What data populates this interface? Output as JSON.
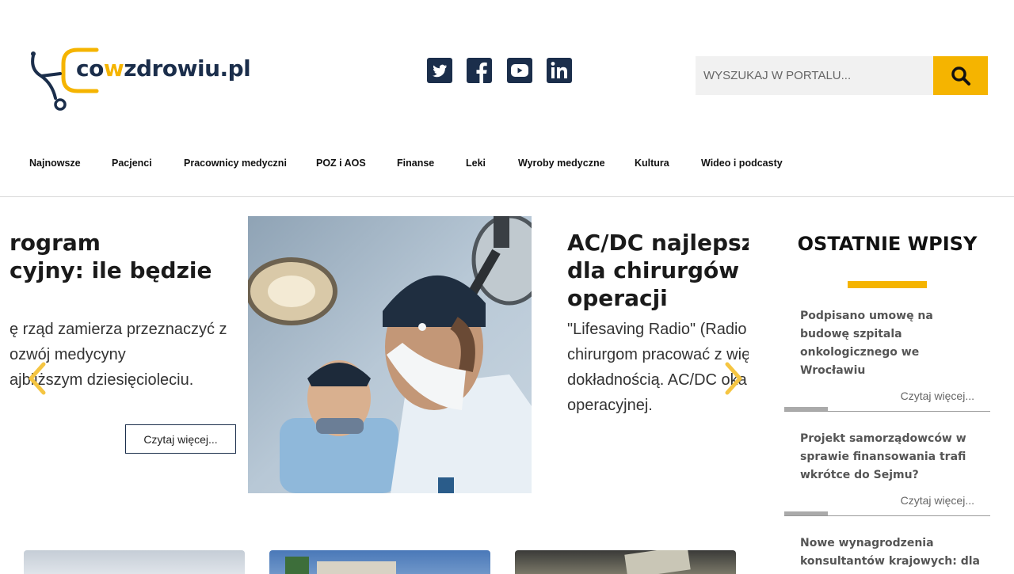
{
  "header": {
    "logo_prefix": "co",
    "logo_accent": "w",
    "logo_suffix": "zdrowiu.pl",
    "search": {
      "placeholder": "WYSZUKAJ W PORTALU..."
    }
  },
  "social": [
    {
      "name": "twitter-icon"
    },
    {
      "name": "facebook-icon"
    },
    {
      "name": "youtube-icon"
    },
    {
      "name": "linkedin-icon"
    }
  ],
  "nav": {
    "items": [
      {
        "label": "Najnowsze"
      },
      {
        "label": "Pacjenci"
      },
      {
        "label": "Pracownicy medyczni"
      },
      {
        "label": "POZ i AOS"
      },
      {
        "label": "Finanse"
      },
      {
        "label": "Leki"
      },
      {
        "label": "Wyroby medyczne"
      },
      {
        "label": "Kultura"
      },
      {
        "label": "Wideo i podcasty"
      }
    ]
  },
  "slider": {
    "left_slide": {
      "title_lines": [
        "rogram",
        "cyjny: ile będzie"
      ],
      "body_lines": [
        "ę rząd zamierza przeznaczyć z",
        "ozwój medycyny",
        "ajbliższym dziesięcioleciu."
      ],
      "button": "Czytaj więcej..."
    },
    "right_slide": {
      "title_lines": [
        "AC/DC najlepsz",
        "dla chirurgów p",
        "operacji"
      ],
      "body_lines": [
        "\"Lifesaving Radio\" (Radio",
        "chirurgom pracować z wię",
        "dokładnością. AC/DC oka",
        "operacyjnej."
      ]
    }
  },
  "sidebar": {
    "title": "OSTATNIE WPISY",
    "posts": [
      {
        "title": "Podpisano umowę na budowę szpitala onkologicznego we Wrocławiu",
        "more": "Czytaj więcej..."
      },
      {
        "title": "Projekt samorządowców w sprawie finansowania trafi wkrótce do Sejmu?",
        "more": "Czytaj więcej..."
      },
      {
        "title": "Nowe wynagrodzenia konsultantów krajowych: dla",
        "more": ""
      }
    ]
  },
  "colors": {
    "accent": "#f5b400",
    "brand": "#1b2e4b"
  }
}
